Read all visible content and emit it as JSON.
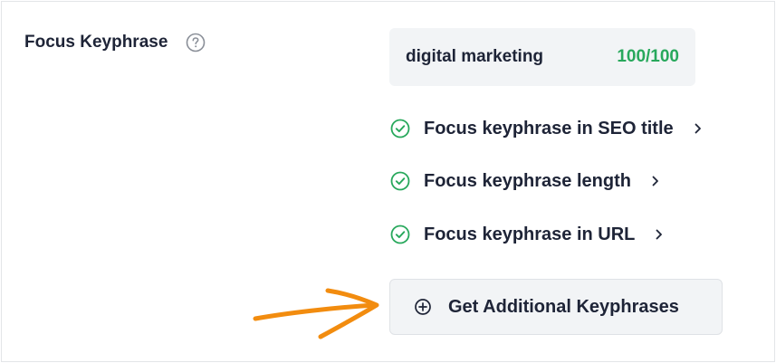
{
  "focus": {
    "label": "Focus Keyphrase",
    "keyphrase": "digital marketing",
    "score": "100/100",
    "score_color": "#28a85c"
  },
  "checks": [
    {
      "label": "Focus keyphrase in SEO title",
      "status": "pass",
      "icon": "check-circle-icon"
    },
    {
      "label": "Focus keyphrase length",
      "status": "pass",
      "icon": "check-circle-icon"
    },
    {
      "label": "Focus keyphrase in URL",
      "status": "pass",
      "icon": "check-circle-icon"
    }
  ],
  "add_button": {
    "label": "Get Additional Keyphrases",
    "icon": "plus-circle-icon"
  },
  "annotation": {
    "icon": "hand-drawn-arrow-icon",
    "color": "#f28c0f"
  }
}
